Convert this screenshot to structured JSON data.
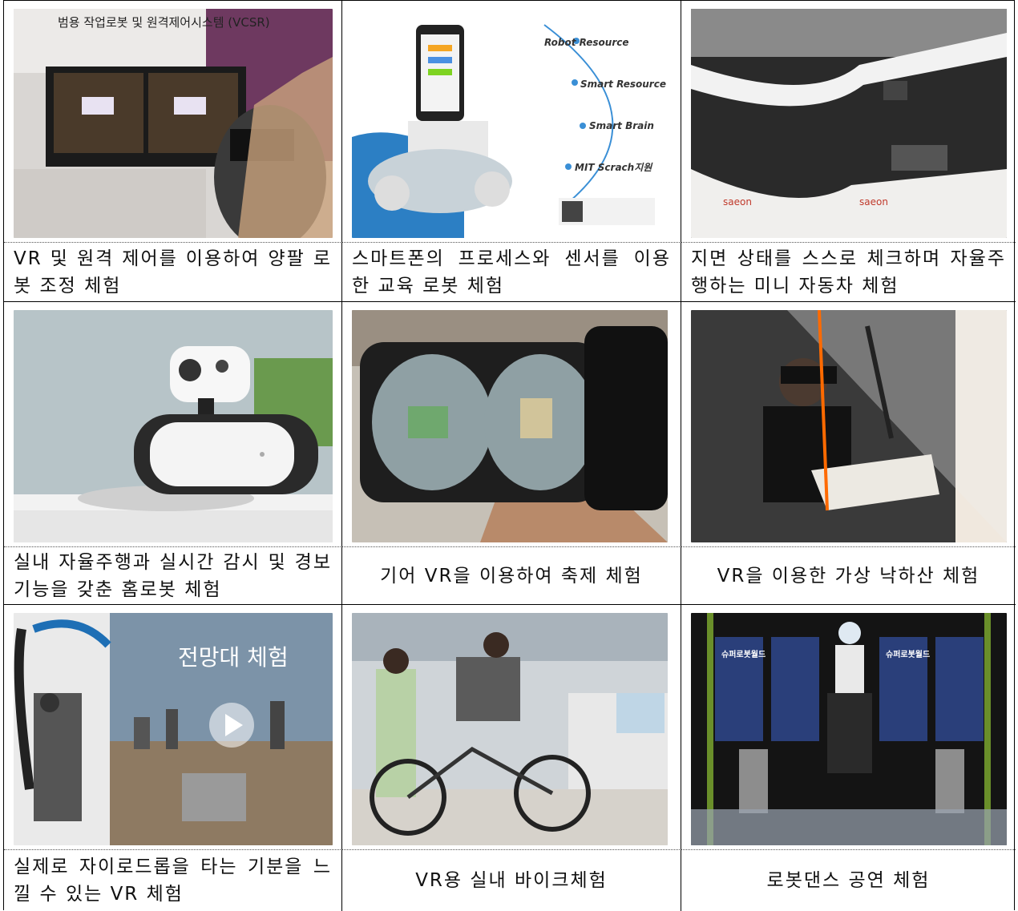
{
  "rows": [
    {
      "cells": [
        {
          "caption": "VR 및 원격 제어를 이용하여 양팔 로봇 조정 체험",
          "photo": "VR robot arm remote control booth",
          "photo_text": "범용 작업로봇 및 원격제어시스템 (VCSR)"
        },
        {
          "caption": "스마트폰의 프로세스와 센서를 이용한 교육 로봇 체험",
          "photo": "smartphone educational robot car",
          "labels": [
            "Robot Resource",
            "Smart Resource",
            "Smart Brain",
            "MIT Scrach지원"
          ]
        },
        {
          "caption": "지면 상태를 스스로 체크하며 자율주행하는 미니 자동차 체험",
          "photo": "mini autonomous car track"
        }
      ]
    },
    {
      "cells": [
        {
          "caption": "실내 자율주행과 실시간 감시 및 경보 기능을 갖춘 홈로봇 체험",
          "photo": "white home robot"
        },
        {
          "caption": "기어 VR을 이용하여 축제 체험",
          "photo": "gear VR headset with phone"
        },
        {
          "caption": "VR을 이용한 가상 낙하산 체험",
          "photo": "VR paragliding simulator"
        }
      ]
    },
    {
      "cells": [
        {
          "caption": "실제로 자이로드롭을 타는 기분을 느낄 수 있는 VR 체험",
          "photo": "VR gyro drop and city view",
          "photo_text": "전망대 체험"
        },
        {
          "caption": "VR용 실내 바이크체험",
          "photo": "indoor VR bicycle"
        },
        {
          "caption": "로봇댄스 공연 체험",
          "photo": "robot dance stage",
          "poster_text": "슈퍼로봇월드"
        }
      ]
    }
  ]
}
